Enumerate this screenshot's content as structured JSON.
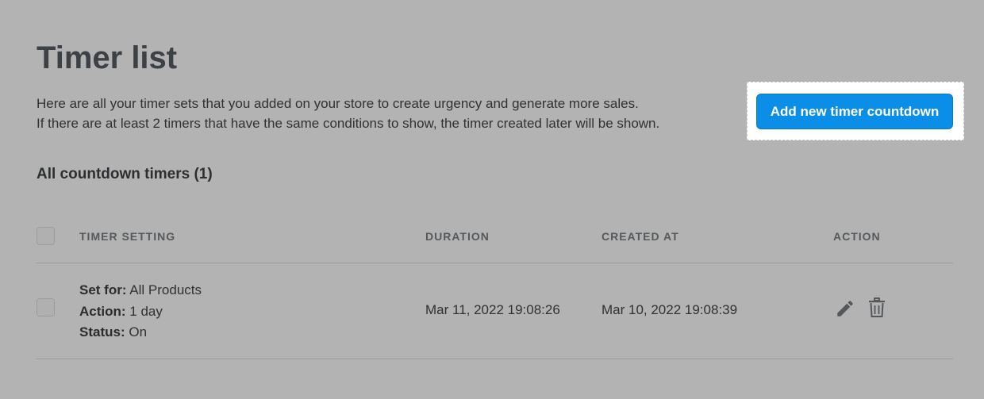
{
  "header": {
    "title": "Timer list",
    "description_line1": "Here are all your timer sets that you added on your store to create urgency and generate more sales.",
    "description_line2": "If there are at least 2 timers that have the same conditions to show, the timer created later will be shown."
  },
  "actions": {
    "add_button_label": "Add new timer countdown"
  },
  "section": {
    "title": "All countdown timers (1)"
  },
  "table": {
    "columns": [
      "TIMER SETTING",
      "DURATION",
      "CREATED AT",
      "ACTION"
    ],
    "rows": [
      {
        "set_for_label": "Set for:",
        "set_for_value": "All Products",
        "action_label": "Action:",
        "action_value": "1 day",
        "status_label": "Status:",
        "status_value": "On",
        "duration": "Mar 11, 2022 19:08:26",
        "created_at": "Mar 10, 2022 19:08:39",
        "icons": [
          "pencil-icon",
          "trash-icon"
        ]
      }
    ]
  },
  "colors": {
    "overlay_background": "#b3b3b3",
    "primary_button": "#0a8ee8",
    "spotlight": "#ffffff"
  }
}
